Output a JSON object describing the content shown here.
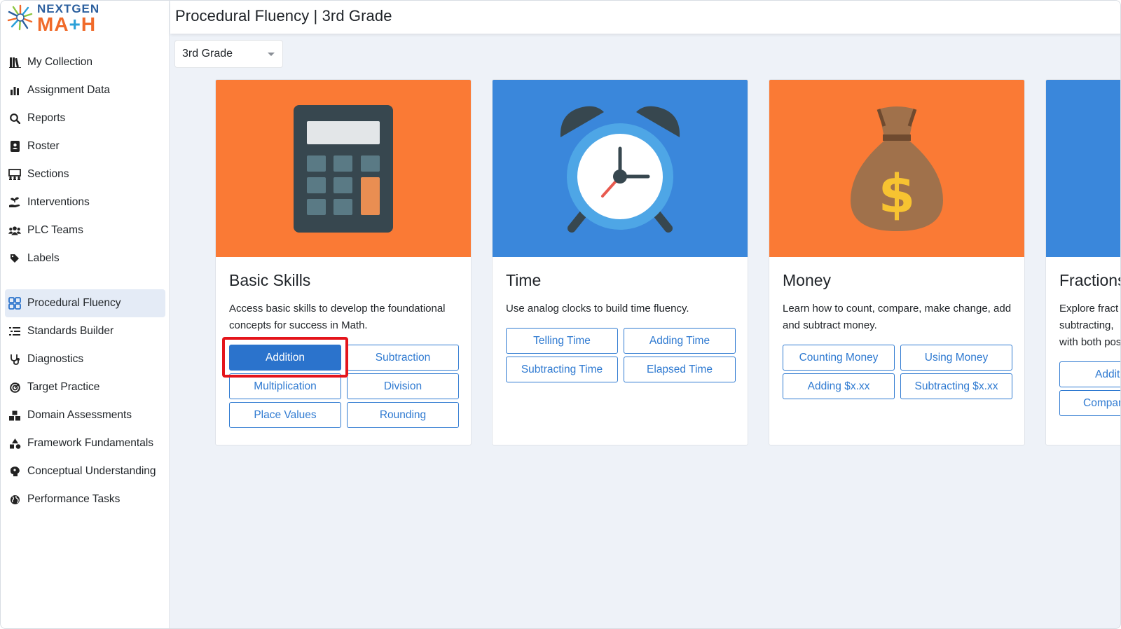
{
  "brand": {
    "top": "NEXTGEN",
    "bottom_left": "MA",
    "bottom_plus": "+",
    "bottom_right": "H"
  },
  "header": {
    "title": "Procedural Fluency | 3rd Grade"
  },
  "grade_select": {
    "value": "3rd Grade"
  },
  "sidebar": {
    "group1": [
      {
        "label": "My Collection",
        "icon": "books-icon"
      },
      {
        "label": "Assignment Data",
        "icon": "bar-chart-icon"
      },
      {
        "label": "Reports",
        "icon": "search-report-icon"
      },
      {
        "label": "Roster",
        "icon": "contact-book-icon"
      },
      {
        "label": "Sections",
        "icon": "classroom-icon"
      },
      {
        "label": "Interventions",
        "icon": "hand-plant-icon"
      },
      {
        "label": "PLC Teams",
        "icon": "users-icon"
      },
      {
        "label": "Labels",
        "icon": "tag-icon"
      }
    ],
    "group2": [
      {
        "label": "Procedural Fluency",
        "icon": "grid-icon",
        "active": true
      },
      {
        "label": "Standards Builder",
        "icon": "list-icon"
      },
      {
        "label": "Diagnostics",
        "icon": "stethoscope-icon"
      },
      {
        "label": "Target Practice",
        "icon": "target-icon"
      },
      {
        "label": "Domain Assessments",
        "icon": "cubes-icon"
      },
      {
        "label": "Framework Fundamentals",
        "icon": "shapes-icon"
      },
      {
        "label": "Conceptual Understanding",
        "icon": "brain-icon"
      },
      {
        "label": "Performance Tasks",
        "icon": "globe-icon"
      }
    ]
  },
  "cards": [
    {
      "title": "Basic Skills",
      "desc": "Access basic skills to develop the foundational concepts for success in Math.",
      "hero_color": "#fa7a35",
      "hero_icon": "calculator-icon",
      "buttons": [
        "Addition",
        "Subtraction",
        "Multiplication",
        "Division",
        "Place Values",
        "Rounding"
      ]
    },
    {
      "title": "Time",
      "desc": "Use analog clocks to build time fluency.",
      "hero_color": "#3a87db",
      "hero_icon": "alarm-clock-icon",
      "buttons": [
        "Telling Time",
        "Adding Time",
        "Subtracting Time",
        "Elapsed Time"
      ]
    },
    {
      "title": "Money",
      "desc": "Learn how to count, compare, make change, add and subtract money.",
      "hero_color": "#fa7a35",
      "hero_icon": "money-bag-icon",
      "buttons": [
        "Counting Money",
        "Using Money",
        "Adding $x.xx",
        "Subtracting $x.xx"
      ]
    },
    {
      "title": "Fractions",
      "desc_lines": [
        "Explore fract",
        "subtracting, ",
        "with both pos"
      ],
      "hero_color": "#3a87db",
      "buttons": [
        "Additi",
        "Compar"
      ]
    }
  ],
  "colors": {
    "accent": "#2b73cc",
    "highlight": "#e4141b",
    "orange": "#fa7a35",
    "blue": "#3a87db"
  }
}
